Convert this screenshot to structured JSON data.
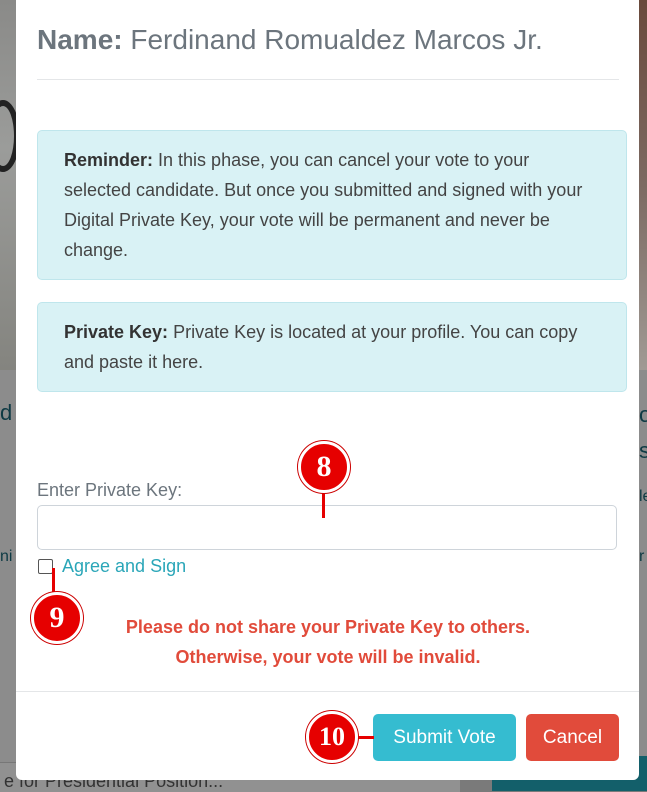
{
  "background": {
    "left_fragments": [
      "d",
      "ni"
    ],
    "right_fragments": [
      "o",
      "s",
      "le",
      "r"
    ],
    "select_text": "e for Presidential Position..."
  },
  "modal": {
    "name_label": "Name:",
    "name_value": "Ferdinand Romualdez Marcos Jr.",
    "reminder": {
      "label": "Reminder:",
      "text": "In this phase, you can cancel your vote to your selected candidate. But once you submitted and signed with your Digital Private Key, your vote will be permanent and never be change."
    },
    "private_key_info": {
      "label": "Private Key:",
      "text": "Private Key is located at your profile. You can copy and paste it here."
    },
    "input_label": "Enter Private Key:",
    "input_value": "",
    "checkbox_label": "Agree and Sign",
    "warning_line1": "Please do not share your Private Key to others.",
    "warning_line2": "Otherwise, your vote will be invalid.",
    "submit_label": "Submit Vote",
    "cancel_label": "Cancel"
  },
  "markers": [
    "8",
    "9",
    "10"
  ],
  "colors": {
    "accent": "#35bcd0",
    "danger": "#e14b3b",
    "alert_bg": "#d9f2f5",
    "marker": "#e60000"
  }
}
